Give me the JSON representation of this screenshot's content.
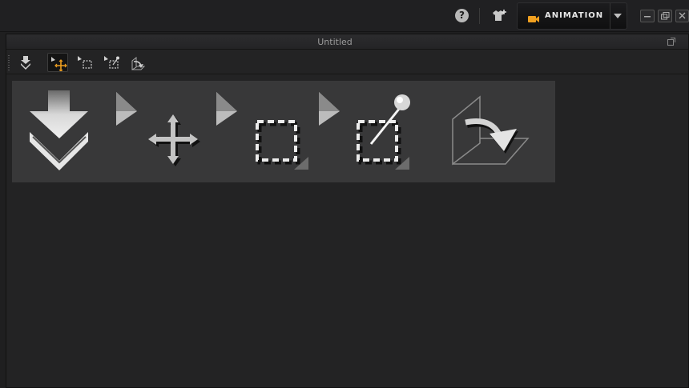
{
  "topbar": {
    "help_label": "?",
    "workspace_label": "ANIMATION",
    "workspace_icon": "camera-icon",
    "accent_color": "#f0a020"
  },
  "panel": {
    "title": "Untitled"
  },
  "toolbar": {
    "tools": [
      {
        "name": "drop-down-tool",
        "icon": "double-down-arrow-icon"
      },
      {
        "name": "move-tool",
        "icon": "move-arrows-icon",
        "active": true
      },
      {
        "name": "select-region-tool",
        "icon": "dashed-select-icon"
      },
      {
        "name": "lasso-select-tool",
        "icon": "dashed-select-pin-icon"
      },
      {
        "name": "3d-transform-tool",
        "icon": "rotate-3d-icon"
      }
    ]
  },
  "shelf": {
    "icons": [
      "double-down-arrow-icon",
      "move-arrows-icon",
      "dashed-select-icon",
      "dashed-select-pin-icon",
      "rotate-3d-icon"
    ]
  }
}
